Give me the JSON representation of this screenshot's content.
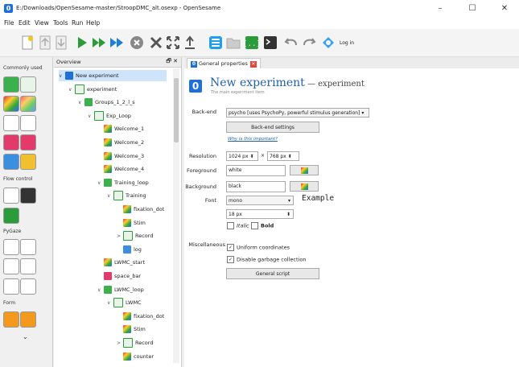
{
  "window": {
    "title": "E:/Downloads/OpenSesame-master/StroopDMC_alt.osexp - OpenSesame",
    "controls": {
      "minimize": "–",
      "maximize": "☐",
      "close": "✕"
    }
  },
  "menu": [
    "File",
    "Edit",
    "View",
    "Tools",
    "Run",
    "Help"
  ],
  "toolbar": {
    "login_label": "Log in"
  },
  "palette": {
    "sections": [
      "Commonly used",
      "Flow control",
      "PyGaze",
      "Form"
    ]
  },
  "overview": {
    "header": "Overview",
    "header_controls": "🗗 ✕",
    "items": [
      {
        "label": "New experiment",
        "level": 0,
        "chev": "∨",
        "icon": "opensesame"
      },
      {
        "label": "experiment",
        "level": 1,
        "chev": "∨",
        "icon": "sequence"
      },
      {
        "label": "Groups_1_2_l_s",
        "level": 2,
        "chev": "∨",
        "icon": "loop"
      },
      {
        "label": "Exp_Loop",
        "level": 3,
        "chev": "∨",
        "icon": "sequence"
      },
      {
        "label": "Welcome_1",
        "level": 4,
        "chev": "",
        "icon": "sketchpad"
      },
      {
        "label": "Welcome_2",
        "level": 4,
        "chev": "",
        "icon": "sketchpad"
      },
      {
        "label": "Welcome_3",
        "level": 4,
        "chev": "",
        "icon": "sketchpad"
      },
      {
        "label": "Welcome_4",
        "level": 4,
        "chev": "",
        "icon": "sketchpad"
      },
      {
        "label": "Training_loop",
        "level": 4,
        "chev": "∨",
        "icon": "loop"
      },
      {
        "label": "Training",
        "level": 5,
        "chev": "∨",
        "icon": "sequence"
      },
      {
        "label": "fixation_dot",
        "level": 6,
        "chev": "",
        "icon": "sketchpad"
      },
      {
        "label": "Stim",
        "level": 6,
        "chev": "",
        "icon": "sketchpad"
      },
      {
        "label": "Record",
        "level": 6,
        "chev": ">",
        "icon": "sequence"
      },
      {
        "label": "log",
        "level": 6,
        "chev": "",
        "icon": "logger"
      },
      {
        "label": "LWMC_start",
        "level": 4,
        "chev": "",
        "icon": "sketchpad"
      },
      {
        "label": "space_bar",
        "level": 4,
        "chev": "",
        "icon": "keyboard"
      },
      {
        "label": "LWMC_loop",
        "level": 4,
        "chev": "∨",
        "icon": "loop"
      },
      {
        "label": "LWMC",
        "level": 5,
        "chev": "∨",
        "icon": "sequence"
      },
      {
        "label": "fixation_dot",
        "level": 6,
        "chev": "",
        "icon": "sketchpad"
      },
      {
        "label": "Stim",
        "level": 6,
        "chev": "",
        "icon": "sketchpad"
      },
      {
        "label": "Record",
        "level": 6,
        "chev": ">",
        "icon": "sequence"
      },
      {
        "label": "counter",
        "level": 6,
        "chev": "",
        "icon": "sketchpad"
      }
    ]
  },
  "tab": {
    "label": "General properties",
    "close": "✕"
  },
  "header": {
    "title": "New experiment",
    "title_suffix": " — experiment",
    "subtitle": "The main experiment item"
  },
  "form": {
    "backend_label": "Back-end",
    "backend_value": "psycho [uses PsychoPy, powerful stimulus generation]",
    "backend_settings": "Back-end settings",
    "why_link": "Why is this important?",
    "resolution_label": "Resolution",
    "res_w": "1024 px",
    "res_x": "×",
    "res_h": "768 px",
    "foreground_label": "Foreground",
    "foreground_value": "white",
    "background_label": "Background",
    "background_value": "black",
    "font_label": "Font",
    "font_value": "mono",
    "font_example": "Example",
    "font_size": "18 px",
    "italic": "Italic",
    "bold": "Bold",
    "misc_label": "Miscellaneous",
    "uniform": "Uniform coordinates",
    "garbage": "Disable garbage collection",
    "general_script": "General script"
  },
  "colors": {
    "accent": "#1e6fd9",
    "title_blue": "#1e5fb3",
    "selection": "#cde4fb",
    "tab_close": "#e04a3c"
  }
}
